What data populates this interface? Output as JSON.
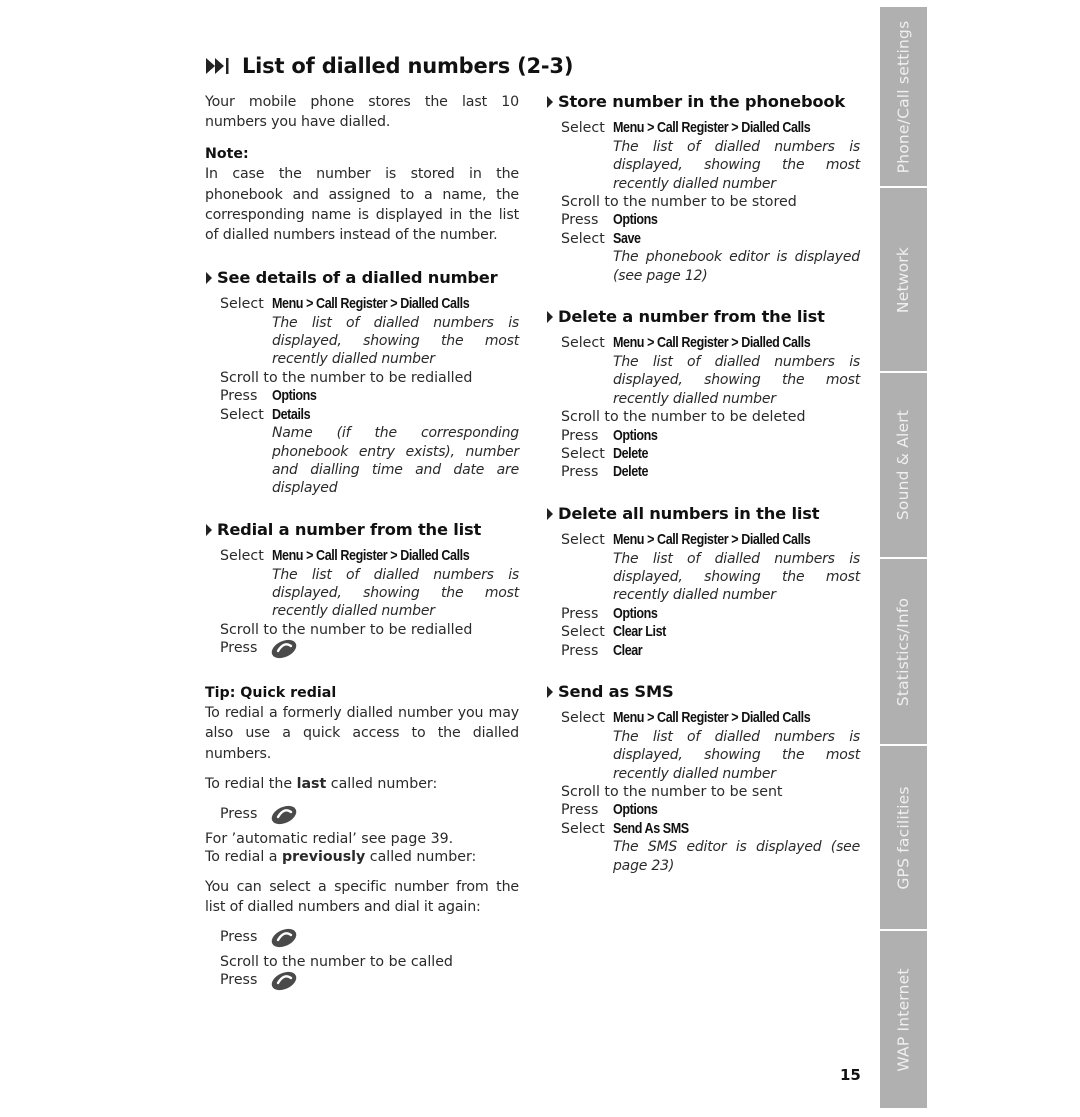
{
  "page": {
    "title": "List of dialled numbers (2-3)",
    "title_icon": "fast-forward-end-icon",
    "page_number": "15"
  },
  "left": {
    "intro": "Your mobile phone stores the last 10 numbers you have dialled.",
    "note_label": "Note:",
    "note_text": "In case the number is stored in the phonebook and assigned to a name, the corresponding name is displayed in the list of dialled numbers instead of the number.",
    "sections": [
      {
        "title": "See details of a dialled number",
        "step1_verb": "Select",
        "step1_obj": "Menu > Call Register > Dialled Calls",
        "step1_desc": "The list of dialled numbers is displayed, showing the most recently dialled number",
        "scroll": "Scroll to the number to be redialled",
        "step2_verb": "Press",
        "step2_obj": "Options",
        "step3_verb": "Select",
        "step3_obj": "Details",
        "step3_desc": "Name (if the corresponding phonebook entry exists), number and dialling time and date are displayed"
      },
      {
        "title": "Redial a number from the list",
        "step1_verb": "Select",
        "step1_obj": "Menu > Call Register > Dialled Calls",
        "step1_desc": "The list of dialled numbers is displayed, showing the most recently dialled number",
        "scroll": "Scroll to the number to be redialled",
        "step2_verb": "Press",
        "step2_icon": "call-key-icon"
      }
    ],
    "tip": {
      "label": "Tip: Quick redial",
      "text": "To redial a formerly dialled number you may also use a quick access to the dialled numbers.",
      "last_prefix": "To redial the ",
      "last_bold": "last",
      "last_suffix": " called number:",
      "press": "Press",
      "automatic": "For ’automatic redial’ see page 39.",
      "prev_prefix": "To redial a ",
      "prev_bold": "previously",
      "prev_suffix": " called number:",
      "select_text": "You can select a specific number from the list of dialled numbers and dial it again:",
      "press2": "Press",
      "scroll": "Scroll to the number to be called",
      "press3": "Press"
    }
  },
  "right": {
    "sections": [
      {
        "title": "Store number in the phonebook",
        "step1_verb": "Select",
        "step1_obj": "Menu > Call Register > Dialled Calls",
        "step1_desc": "The list of dialled numbers is displayed, showing the most recently dialled number",
        "scroll": "Scroll to the number to be stored",
        "step2_verb": "Press",
        "step2_obj": "Options",
        "step3_verb": "Select",
        "step3_obj": "Save",
        "step3_desc": "The phonebook editor is displayed (see page 12)"
      },
      {
        "title": "Delete a number from the list",
        "step1_verb": "Select",
        "step1_obj": "Menu > Call Register > Dialled Calls",
        "step1_desc": "The list of dialled numbers is displayed, showing the most recently dialled number",
        "scroll": "Scroll to the number to be deleted",
        "step2_verb": "Press",
        "step2_obj": "Options",
        "step3_verb": "Select",
        "step3_obj": "Delete",
        "step4_verb": "Press",
        "step4_obj": "Delete"
      },
      {
        "title": "Delete all numbers in the list",
        "step1_verb": "Select",
        "step1_obj": "Menu > Call Register > Dialled Calls",
        "step1_desc": "The list of dialled numbers is displayed, showing the most recently dialled number",
        "step2_verb": "Press",
        "step2_obj": "Options",
        "step3_verb": "Select",
        "step3_obj": "Clear List",
        "step4_verb": "Press",
        "step4_obj": "Clear"
      },
      {
        "title": "Send as SMS",
        "step1_verb": "Select",
        "step1_obj": "Menu > Call Register > Dialled Calls",
        "step1_desc": "The list of dialled numbers is displayed, showing the most recently dialled number",
        "scroll": "Scroll to the number to be sent",
        "step2_verb": "Press",
        "step2_obj": "Options",
        "step3_verb": "Select",
        "step3_obj": "Send As SMS",
        "step3_desc": "The SMS editor is displayed (see page 23)"
      }
    ]
  },
  "sidebar": {
    "tabs": [
      {
        "label": "Phone/Call settings"
      },
      {
        "label": "Network"
      },
      {
        "label": "Sound & Alert"
      },
      {
        "label": "Statistics/Info"
      },
      {
        "label": "GPS facilities"
      },
      {
        "label": "WAP Internet"
      }
    ],
    "tab_color": "#b0b0b0",
    "tab_text_color": "#efefef"
  }
}
